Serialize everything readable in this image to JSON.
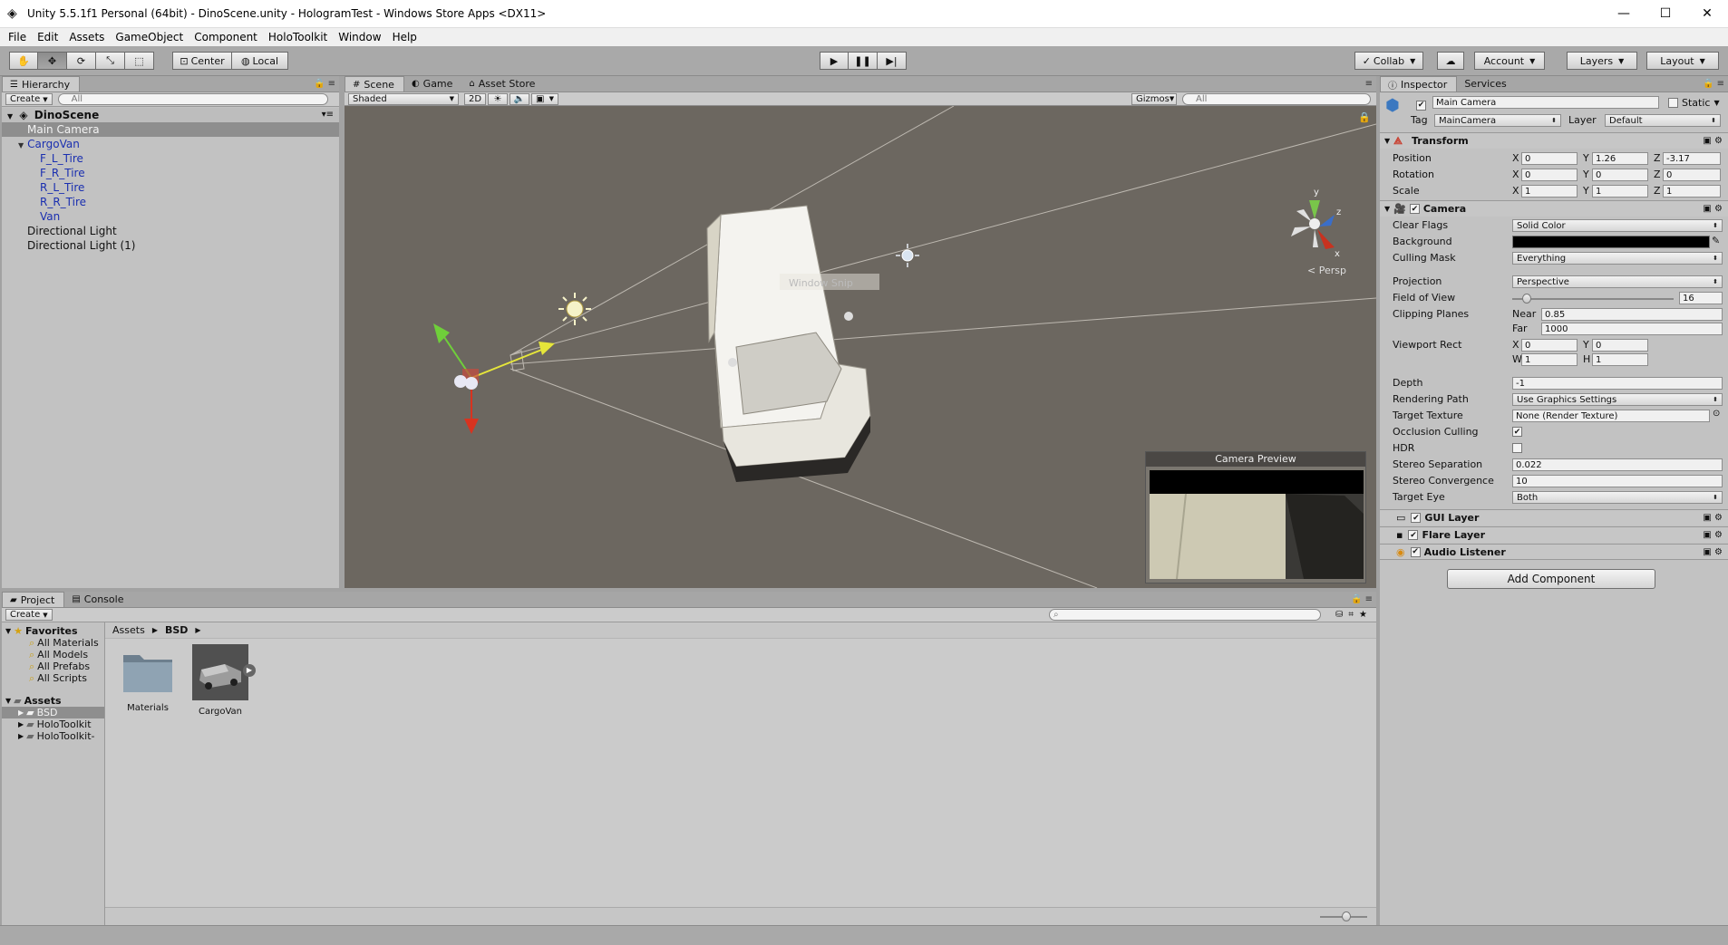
{
  "window": {
    "title": "Unity 5.5.1f1 Personal (64bit) - DinoScene.unity - HologramTest - Windows Store Apps <DX11>",
    "minimize": "—",
    "maximize": "☐",
    "close": "✕"
  },
  "menu": [
    "File",
    "Edit",
    "Assets",
    "GameObject",
    "Component",
    "HoloToolkit",
    "Window",
    "Help"
  ],
  "toolbar": {
    "pivot_center": "Center",
    "pivot_local": "Local",
    "collab": "Collab",
    "account": "Account",
    "layers": "Layers",
    "layout": "Layout"
  },
  "hierarchy": {
    "tab": "Hierarchy",
    "create": "Create",
    "search_placeholder": "All",
    "scene": "DinoScene",
    "items": [
      {
        "label": "Main Camera",
        "indent": 1,
        "selected": true
      },
      {
        "label": "CargoVan",
        "indent": 1,
        "prefab": true,
        "expanded": true
      },
      {
        "label": "F_L_Tire",
        "indent": 2,
        "prefab": true
      },
      {
        "label": "F_R_Tire",
        "indent": 2,
        "prefab": true
      },
      {
        "label": "R_L_Tire",
        "indent": 2,
        "prefab": true
      },
      {
        "label": "R_R_Tire",
        "indent": 2,
        "prefab": true
      },
      {
        "label": "Van",
        "indent": 2,
        "prefab": true
      },
      {
        "label": "Directional Light",
        "indent": 1
      },
      {
        "label": "Directional Light (1)",
        "indent": 1
      }
    ]
  },
  "scene": {
    "tabs": [
      "Scene",
      "Game",
      "Asset Store"
    ],
    "shading": "Shaded",
    "mode_2d": "2D",
    "gizmos": "Gizmos",
    "search_placeholder": "All",
    "persp": "< Persp",
    "axis_y": "y",
    "axis_z": "z",
    "axis_x": "x",
    "window_snip": "Window Snip",
    "camera_preview": "Camera Preview"
  },
  "inspector": {
    "tabs": [
      "Inspector",
      "Services"
    ],
    "object_name": "Main Camera",
    "static_label": "Static",
    "tag_label": "Tag",
    "tag_value": "MainCamera",
    "layer_label": "Layer",
    "layer_value": "Default",
    "transform": {
      "title": "Transform",
      "rows": [
        {
          "label": "Position",
          "x": "0",
          "y": "1.26",
          "z": "-3.17"
        },
        {
          "label": "Rotation",
          "x": "0",
          "y": "0",
          "z": "0"
        },
        {
          "label": "Scale",
          "x": "1",
          "y": "1",
          "z": "1"
        }
      ]
    },
    "camera": {
      "title": "Camera",
      "clear_flags_label": "Clear Flags",
      "clear_flags": "Solid Color",
      "background_label": "Background",
      "culling_mask_label": "Culling Mask",
      "culling_mask": "Everything",
      "projection_label": "Projection",
      "projection": "Perspective",
      "fov_label": "Field of View",
      "fov": "16",
      "fov_fraction": 0.09,
      "clipping_label": "Clipping Planes",
      "near_label": "Near",
      "near": "0.85",
      "far_label": "Far",
      "far": "1000",
      "viewport_label": "Viewport Rect",
      "vx": "0",
      "vy": "0",
      "vw": "1",
      "vh": "1",
      "depth_label": "Depth",
      "depth": "-1",
      "rendering_path_label": "Rendering Path",
      "rendering_path": "Use Graphics Settings",
      "target_texture_label": "Target Texture",
      "target_texture": "None (Render Texture)",
      "occlusion_label": "Occlusion Culling",
      "hdr_label": "HDR",
      "stereo_sep_label": "Stereo Separation",
      "stereo_sep": "0.022",
      "stereo_conv_label": "Stereo Convergence",
      "stereo_conv": "10",
      "target_eye_label": "Target Eye",
      "target_eye": "Both"
    },
    "gui_layer": "GUI Layer",
    "flare_layer": "Flare Layer",
    "audio_listener": "Audio Listener",
    "add_component": "Add Component"
  },
  "project": {
    "tabs": [
      "Project",
      "Console"
    ],
    "create": "Create",
    "favorites_label": "Favorites",
    "favorites": [
      "All Materials",
      "All Models",
      "All Prefabs",
      "All Scripts"
    ],
    "assets_label": "Assets",
    "asset_folders": [
      "BSD",
      "HoloToolkit",
      "HoloToolkit-"
    ],
    "breadcrumb_root": "Assets",
    "breadcrumb_current": "BSD",
    "items": [
      "Materials",
      "CargoVan"
    ]
  },
  "colors": {
    "camera_background": "#000000",
    "viewport": "#6c6760",
    "selection": "#8e8e8e",
    "prefab_text": "#1a2fb0"
  }
}
